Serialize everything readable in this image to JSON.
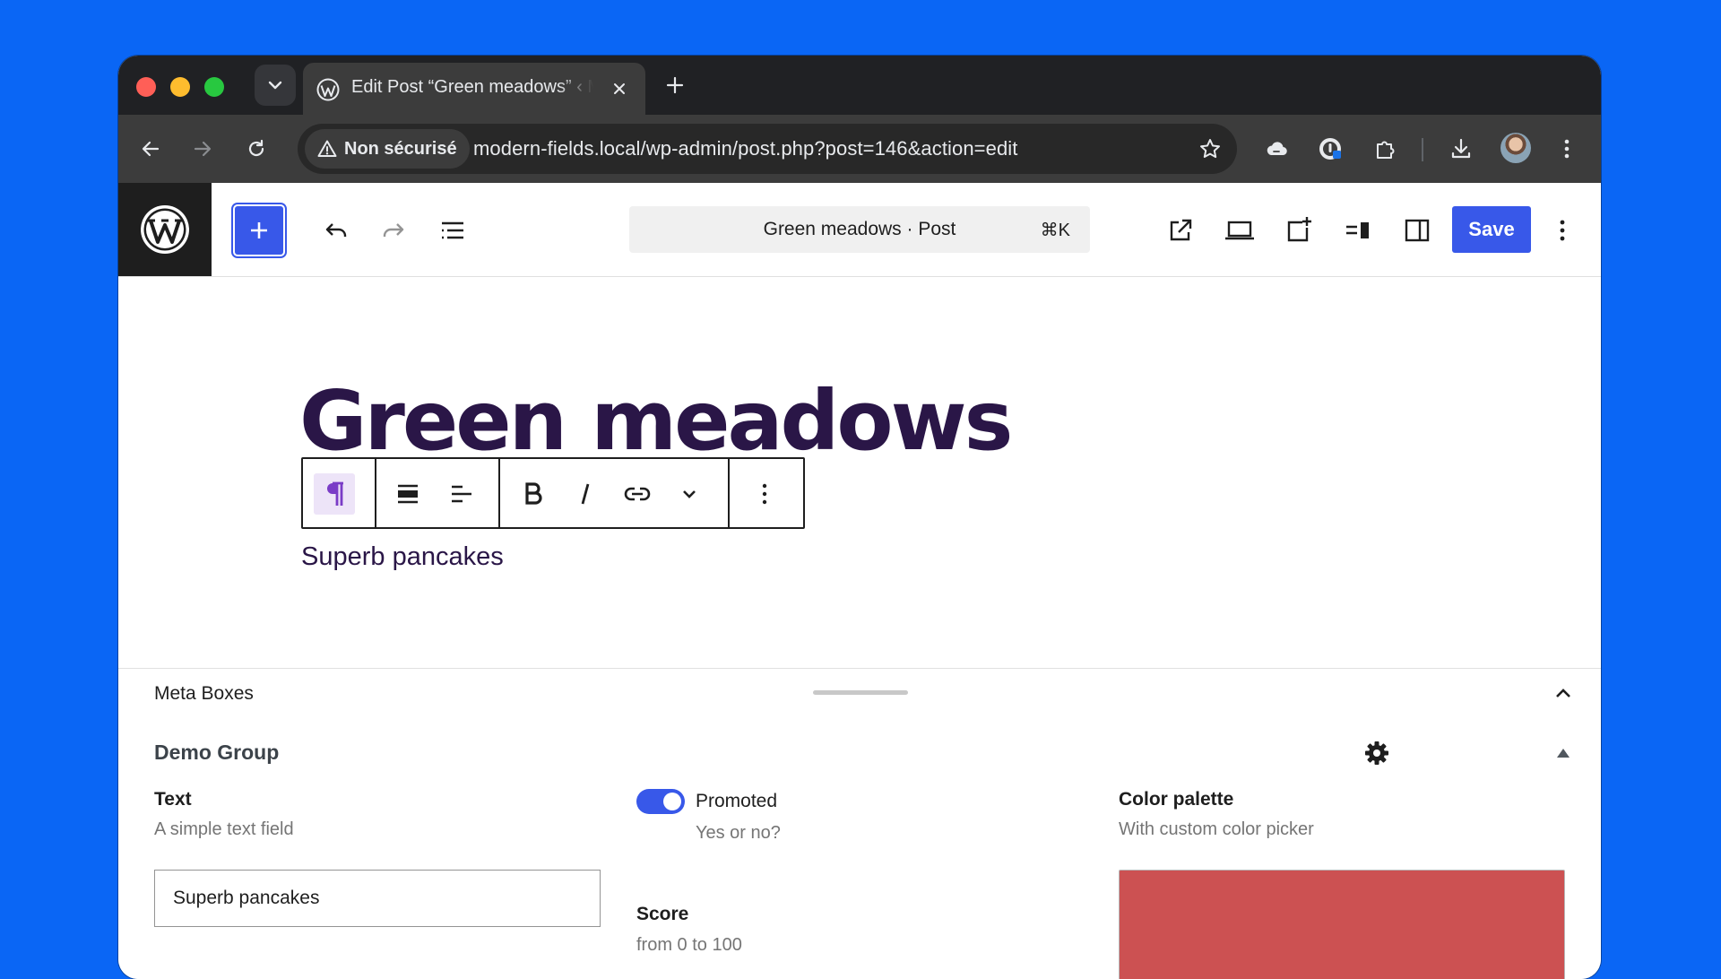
{
  "browser": {
    "tab_title": "Edit Post “Green meadows” ‹ Modern Fields — WordPress",
    "security_label": "Non sécurisé",
    "url": "modern-fields.local/wp-admin/post.php?post=146&action=edit"
  },
  "editor": {
    "command_title": "Green meadows · Post",
    "command_shortcut": "⌘K",
    "save_label": "Save",
    "post_title": "Green meadows",
    "paragraph": "Superb pancakes"
  },
  "meta": {
    "header_title": "Meta Boxes",
    "group_title": "Demo Group",
    "text_field": {
      "label": "Text",
      "help": "A simple text field",
      "value": "Superb pancakes"
    },
    "toggle_field": {
      "label": "Promoted",
      "help": "Yes or no?",
      "checked": true
    },
    "score_field": {
      "label": "Score",
      "help": "from 0 to 100"
    },
    "color_field": {
      "label": "Color palette",
      "help": "With custom color picker",
      "value": "#cc5152"
    }
  },
  "colors": {
    "accent": "#3858e9",
    "title": "#2a1647",
    "page_bg": "#0a66f5"
  }
}
